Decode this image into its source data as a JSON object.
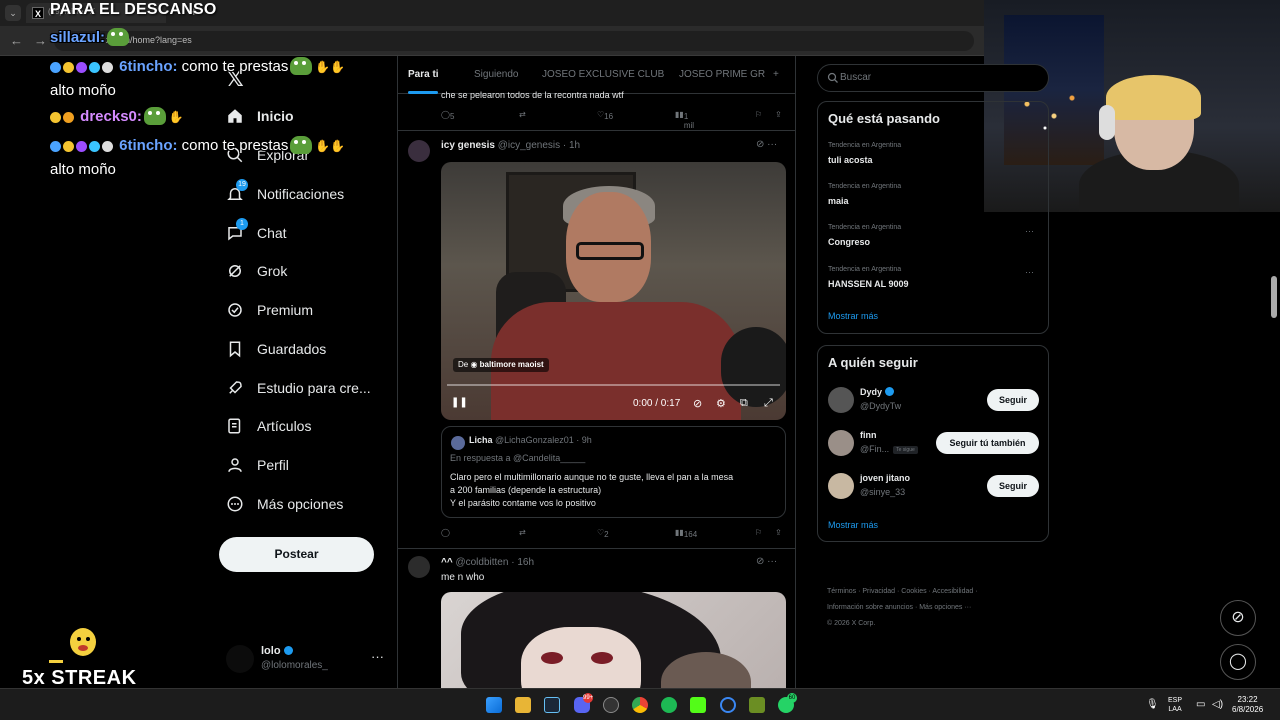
{
  "browser": {
    "tab_title": "(19) Inicio / X",
    "url": "x.com/home?lang=es"
  },
  "overlay": {
    "title": "PARA EL DESCANSO",
    "chat": [
      {
        "user": "sillazul:",
        "user_color": "#6aa3ff",
        "message": ""
      },
      {
        "user": "6tincho:",
        "user_color": "#6aa3ff",
        "message": " como te prestas"
      },
      {
        "user": "",
        "user_color": "#ffffff",
        "message": "alto moño"
      },
      {
        "user": "drecks0:",
        "user_color": "#d58bff",
        "message": ""
      },
      {
        "user": "6tincho:",
        "user_color": "#6aa3ff",
        "message": " como te prestas"
      },
      {
        "user": "",
        "user_color": "#ffffff",
        "message": "alto moño"
      }
    ],
    "streak": "5x STREAK"
  },
  "nav": {
    "items": [
      {
        "label": "Inicio",
        "icon": "home-icon",
        "badge": ""
      },
      {
        "label": "Explorar",
        "icon": "search-icon",
        "badge": ""
      },
      {
        "label": "Notificaciones",
        "icon": "bell-icon",
        "badge": "19"
      },
      {
        "label": "Chat",
        "icon": "chat-icon",
        "badge": "1"
      },
      {
        "label": "Grok",
        "icon": "grok-icon",
        "badge": ""
      },
      {
        "label": "Premium",
        "icon": "premium-icon",
        "badge": ""
      },
      {
        "label": "Guardados",
        "icon": "bookmark-icon",
        "badge": ""
      },
      {
        "label": "Estudio para cre...",
        "icon": "rocket-icon",
        "badge": ""
      },
      {
        "label": "Artículos",
        "icon": "article-icon",
        "badge": ""
      },
      {
        "label": "Perfil",
        "icon": "person-icon",
        "badge": ""
      },
      {
        "label": "Más opciones",
        "icon": "more-circle-icon",
        "badge": ""
      }
    ],
    "post_label": "Postear",
    "account": {
      "name": "lolo",
      "handle": "@lolomorales_"
    }
  },
  "feed": {
    "tabs": [
      "Para ti",
      "Siguiendo",
      "JOSEO EXCLUSIVE CLUB",
      "JOSEO PRIME GR"
    ],
    "prev_tweet": {
      "text": "che se pelearon todos de la recontra nada wtf",
      "replies": "5",
      "likes": "16",
      "views": "1 mil"
    },
    "tweet1": {
      "name": "icy genesis",
      "handle": "@icy_genesis · 1h",
      "video": {
        "from_label": "De",
        "from_user": "baltimore maoist",
        "time": "0:00 / 0:17",
        "progress": 0.0
      },
      "quote": {
        "name": "Licha",
        "handle": "@LichaGonzalez01 · 9h",
        "reply_to": "En respuesta a @Candelita_____",
        "line1": "Claro pero el multimillonario aunque no te guste, lleva el pan a la mesa",
        "line2": "a 200 familias (depende la estructura)",
        "line3": "Y el parásito contame vos lo positivo"
      },
      "likes": "2",
      "views": "164"
    },
    "tweet2": {
      "name": "^^",
      "handle": "@coldbitten · 16h",
      "text": "me n who"
    }
  },
  "right": {
    "search_placeholder": "Buscar",
    "trends_title": "Qué está pasando",
    "trends": [
      {
        "category": "Tendencia en Argentina",
        "name": "tuli acosta"
      },
      {
        "category": "Tendencia en Argentina",
        "name": "maia"
      },
      {
        "category": "Tendencia en Argentina",
        "name": "Congreso"
      },
      {
        "category": "Tendencia en Argentina",
        "name": "HANSSEN AL 9009"
      }
    ],
    "show_more": "Mostrar más",
    "follow_title": "A quién seguir",
    "follow": [
      {
        "name": "Dydy",
        "handle": "@DydyTw",
        "button": "Seguir",
        "follows_you": ""
      },
      {
        "name": "finn",
        "handle": "@Fin...",
        "button": "Seguir tú también",
        "follows_you": "Te sigue"
      },
      {
        "name": "joven jitano",
        "handle": "@sinye_33",
        "button": "Seguir",
        "follows_you": ""
      }
    ],
    "footer": {
      "line1": "Términos  ·  Privacidad  ·  Cookies  ·  Accesibilidad  ·",
      "line2": "Información sobre anuncios  ·  Más opciones ···",
      "line3": "© 2026 X Corp."
    }
  },
  "taskbar": {
    "lang1": "ESP",
    "lang2": "LAA",
    "time": "23:22",
    "date": "6/8/2026",
    "discord_badge": "99+",
    "whatsapp_badge": "60"
  },
  "colors": {
    "accent": "#1d9bf0",
    "background": "#000000",
    "border": "#2f3336"
  }
}
